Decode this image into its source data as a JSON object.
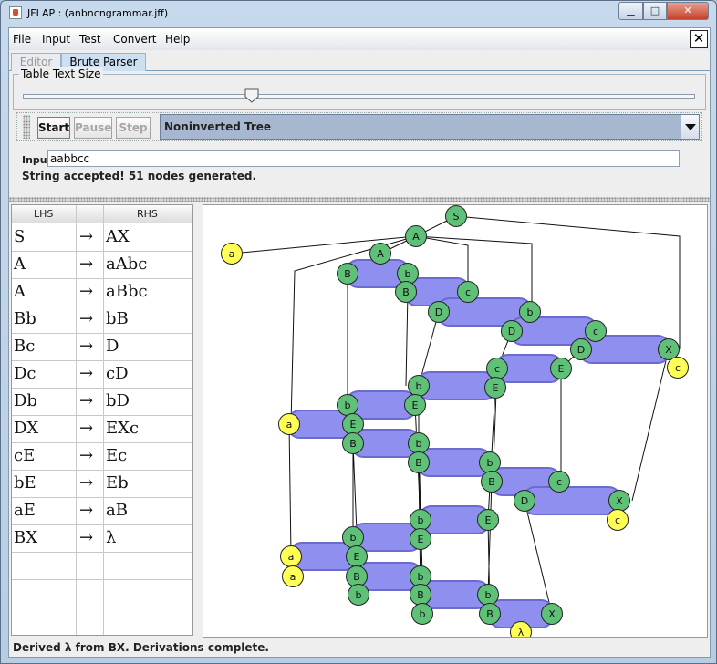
{
  "window": {
    "title": "JFLAP : (anbncngrammar.jff)",
    "minimize_glyph": "▁",
    "maximize_glyph": "□",
    "close_glyph": "✕"
  },
  "menu": {
    "items": [
      "File",
      "Input",
      "Test",
      "Convert",
      "Help"
    ],
    "close_glyph": "✕"
  },
  "tabs": [
    {
      "label": "Editor",
      "active": false
    },
    {
      "label": "Brute Parser",
      "active": true
    }
  ],
  "table_text_size": {
    "label": "Table Text Size",
    "slider_fraction": 0.34
  },
  "controls": {
    "start": "Start",
    "pause": "Pause",
    "step": "Step",
    "view_mode": "Noninverted Tree"
  },
  "input": {
    "label": "Input",
    "value": "aabbcc"
  },
  "status_message": "String accepted!  51 nodes generated.",
  "grammar_table": {
    "headers": [
      "LHS",
      "RHS"
    ],
    "arrow": "→",
    "rows": [
      {
        "lhs": "S",
        "rhs": "AX"
      },
      {
        "lhs": "A",
        "rhs": "aAbc"
      },
      {
        "lhs": "A",
        "rhs": "aBbc"
      },
      {
        "lhs": "Bb",
        "rhs": "bB"
      },
      {
        "lhs": "Bc",
        "rhs": "D"
      },
      {
        "lhs": "Dc",
        "rhs": "cD"
      },
      {
        "lhs": "Db",
        "rhs": "bD"
      },
      {
        "lhs": "DX",
        "rhs": "EXc"
      },
      {
        "lhs": "cE",
        "rhs": "Ec"
      },
      {
        "lhs": "bE",
        "rhs": "Eb"
      },
      {
        "lhs": "aE",
        "rhs": "aB"
      },
      {
        "lhs": "BX",
        "rhs": "λ"
      }
    ]
  },
  "tree": {
    "node_labels": [
      "S",
      "A",
      "a",
      "A",
      "B",
      "b",
      "B",
      "c",
      "D",
      "b",
      "D",
      "c",
      "D",
      "X",
      "c",
      "c",
      "E",
      "b",
      "E",
      "b",
      "E",
      "a",
      "E",
      "B",
      "b",
      "B",
      "b",
      "B",
      "c",
      "D",
      "X",
      "c",
      "b",
      "E",
      "b",
      "E",
      "a",
      "E",
      "a",
      "B",
      "b",
      "b",
      "B",
      "b",
      "b",
      "B",
      "X",
      "λ"
    ],
    "colors": {
      "nonterminal": "#5fc177",
      "terminal": "#ffff55",
      "bar": "#8f8fef",
      "bar_border": "#6b6bcf"
    }
  },
  "status_bar": "Derived λ from BX.  Derivations complete."
}
